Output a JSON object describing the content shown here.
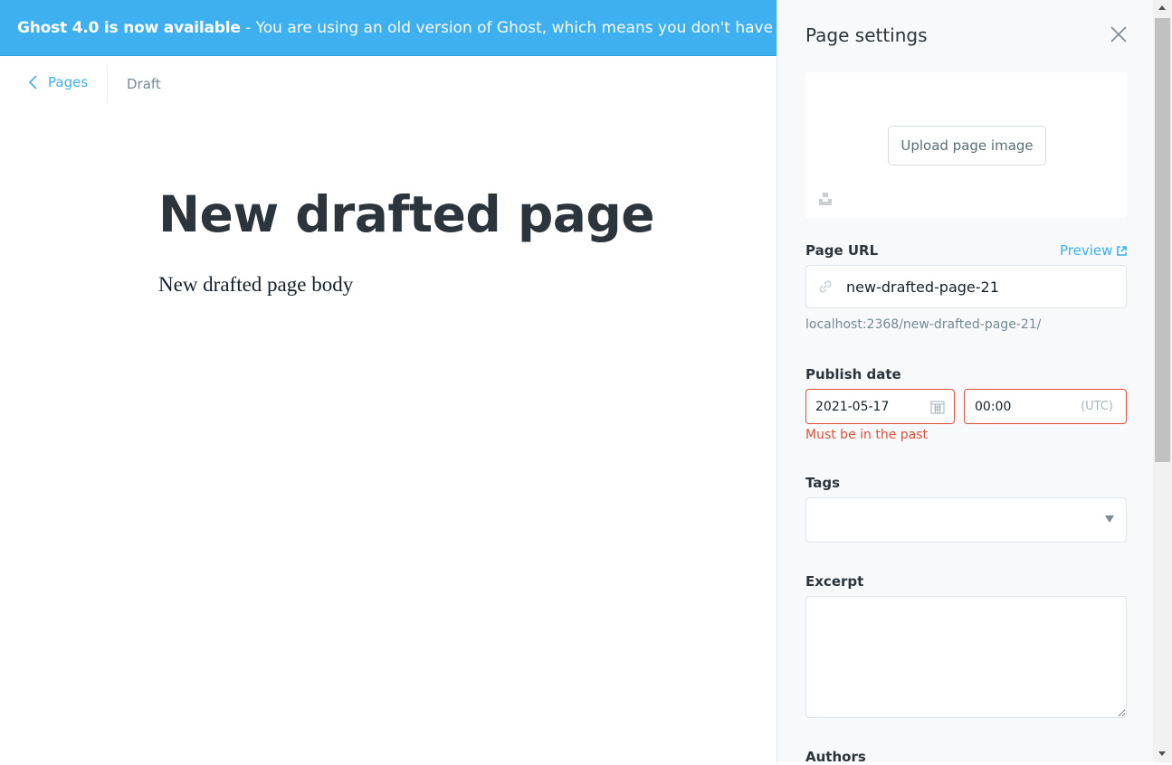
{
  "banner": {
    "bold": "Ghost 4.0 is now available",
    "message": " - You are using an old version of Ghost, which means you don't have access to the latest features."
  },
  "header": {
    "back_label": "Pages",
    "status": "Draft"
  },
  "editor": {
    "title": "New drafted page",
    "body": "New drafted page body"
  },
  "panel": {
    "title": "Page settings",
    "upload_label": "Upload page image",
    "url_label": "Page URL",
    "preview_label": "Preview",
    "slug": "new-drafted-page-21",
    "url_hint": "localhost:2368/new-drafted-page-21/",
    "publish_label": "Publish date",
    "date_value": "2021-05-17",
    "time_value": "00:00",
    "timezone": "(UTC)",
    "date_error": "Must be in the past",
    "tags_label": "Tags",
    "excerpt_label": "Excerpt",
    "authors_label": "Authors"
  },
  "colors": {
    "accent": "#3eb0ef",
    "error": "#e04e39"
  }
}
